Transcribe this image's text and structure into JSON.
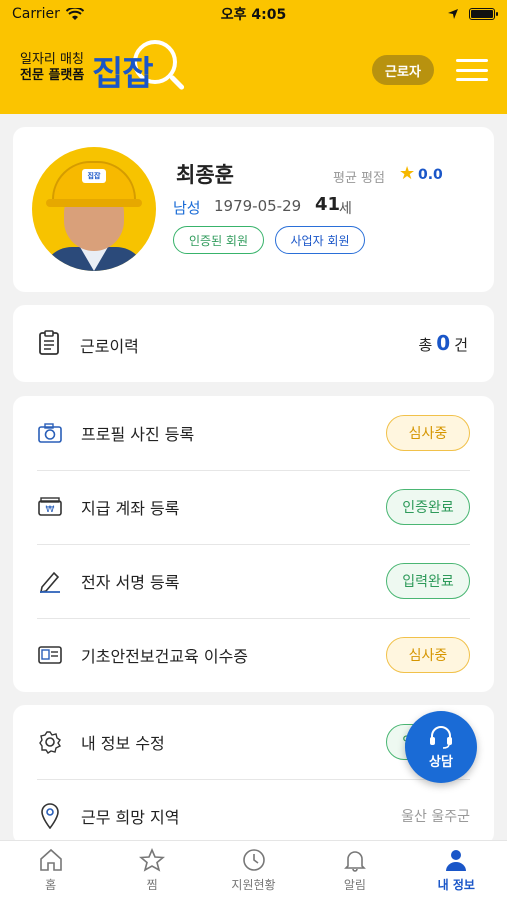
{
  "status_bar": {
    "carrier": "Carrier",
    "time": "오후 4:05",
    "battery_level": 1.0
  },
  "header": {
    "tagline_line1": "일자리 매칭",
    "tagline_line2": "전문 플랫폼",
    "logo": "집잡",
    "role_button": "근로자",
    "menu_icon": "hamburger-menu-icon",
    "background_color": "#fbc400"
  },
  "profile": {
    "name": "최종훈",
    "rating_label": "평균 평점",
    "rating_value": "0.0",
    "gender": "남성",
    "birthdate": "1979-05-29",
    "age": "41",
    "age_unit": "세",
    "badges": [
      "인증된 회원",
      "사업자 회원"
    ]
  },
  "work_history": {
    "label": "근로이력",
    "total_prefix": "총",
    "count": "0",
    "unit": "건",
    "icon": "clipboard-icon"
  },
  "documents": [
    {
      "label": "프로필 사진 등록",
      "status": "심사중",
      "status_type": "pending",
      "icon": "camera-icon"
    },
    {
      "label": "지급 계좌 등록",
      "status": "인증완료",
      "status_type": "done",
      "icon": "bank-account-icon"
    },
    {
      "label": "전자 서명 등록",
      "status": "입력완료",
      "status_type": "done",
      "icon": "pen-icon"
    },
    {
      "label": "기초안전보건교육 이수증",
      "status": "심사중",
      "status_type": "pending",
      "icon": "id-card-icon"
    }
  ],
  "settings": {
    "edit_info": {
      "label": "내 정보 수정",
      "status": "입력완료",
      "icon": "gear-icon"
    },
    "region": {
      "label": "근무 희망 지역",
      "value": "울산 울주군",
      "icon": "location-pin-icon"
    }
  },
  "fab": {
    "label": "상담",
    "icon": "headset-icon"
  },
  "tabs": [
    {
      "label": "홈",
      "icon": "home-icon",
      "active": false
    },
    {
      "label": "찜",
      "icon": "star-icon",
      "active": false
    },
    {
      "label": "지원현황",
      "icon": "clock-icon",
      "active": false
    },
    {
      "label": "알림",
      "icon": "bell-icon",
      "active": false
    },
    {
      "label": "내 정보",
      "icon": "person-icon",
      "active": true
    }
  ],
  "colors": {
    "accent_blue": "#1a56c8",
    "pending_yellow": "#f1c14a",
    "done_green": "#4ab673"
  }
}
